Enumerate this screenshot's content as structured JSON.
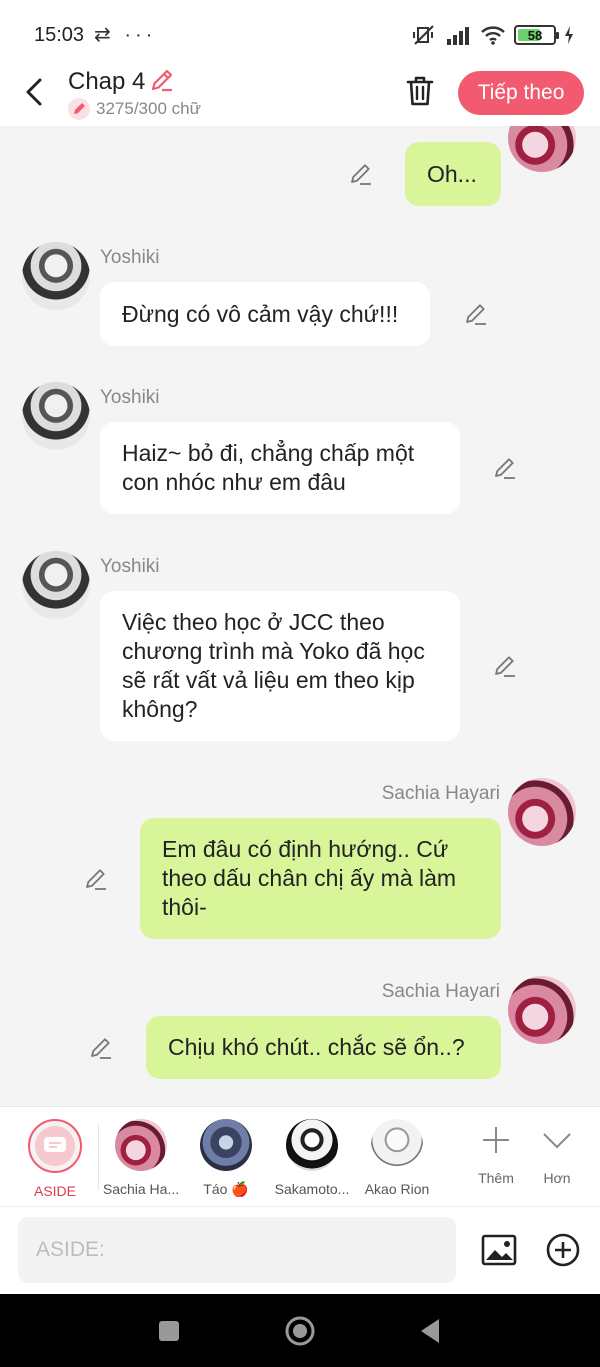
{
  "status_bar": {
    "time": "15:03",
    "left_icons": "⇄ ···",
    "battery": "58"
  },
  "header": {
    "title": "Chap 4",
    "word_count": "3275/300 chữ",
    "next_label": "Tiếp theo"
  },
  "messages": [
    {
      "side": "right",
      "name": "",
      "text": "Oh...",
      "partial": true
    },
    {
      "side": "left",
      "name": "Yoshiki",
      "text": "Đừng có vô cảm vậy chứ!!!"
    },
    {
      "side": "left",
      "name": "Yoshiki",
      "text": "Haiz~ bỏ đi, chẳng chấp một con nhóc như em đâu"
    },
    {
      "side": "left",
      "name": "Yoshiki",
      "text": "Việc theo học ở JCC theo chương trình mà Yoko đã học sẽ rất vất vả liệu em theo kịp không?"
    },
    {
      "side": "right",
      "name": "Sachia Hayari",
      "text": "Em đâu có định hướng.. Cứ theo dấu chân chị ấy mà làm thôi-"
    },
    {
      "side": "right",
      "name": "Sachia Hayari",
      "text": "Chịu khó chút.. chắc sẽ ổn..?"
    }
  ],
  "characters": [
    {
      "label": "ASIDE",
      "selected": true
    },
    {
      "label": "Sachia Ha..."
    },
    {
      "label": "Táo 🍎"
    },
    {
      "label": "Sakamoto..."
    },
    {
      "label": "Akao Rion"
    }
  ],
  "tools": {
    "add_label": "Thêm",
    "more_label": "Hơn"
  },
  "input": {
    "placeholder": "ASIDE:"
  },
  "colors": {
    "accent": "#f25a70",
    "bubble_right": "#d8f59a",
    "bubble_left": "#ffffff"
  }
}
